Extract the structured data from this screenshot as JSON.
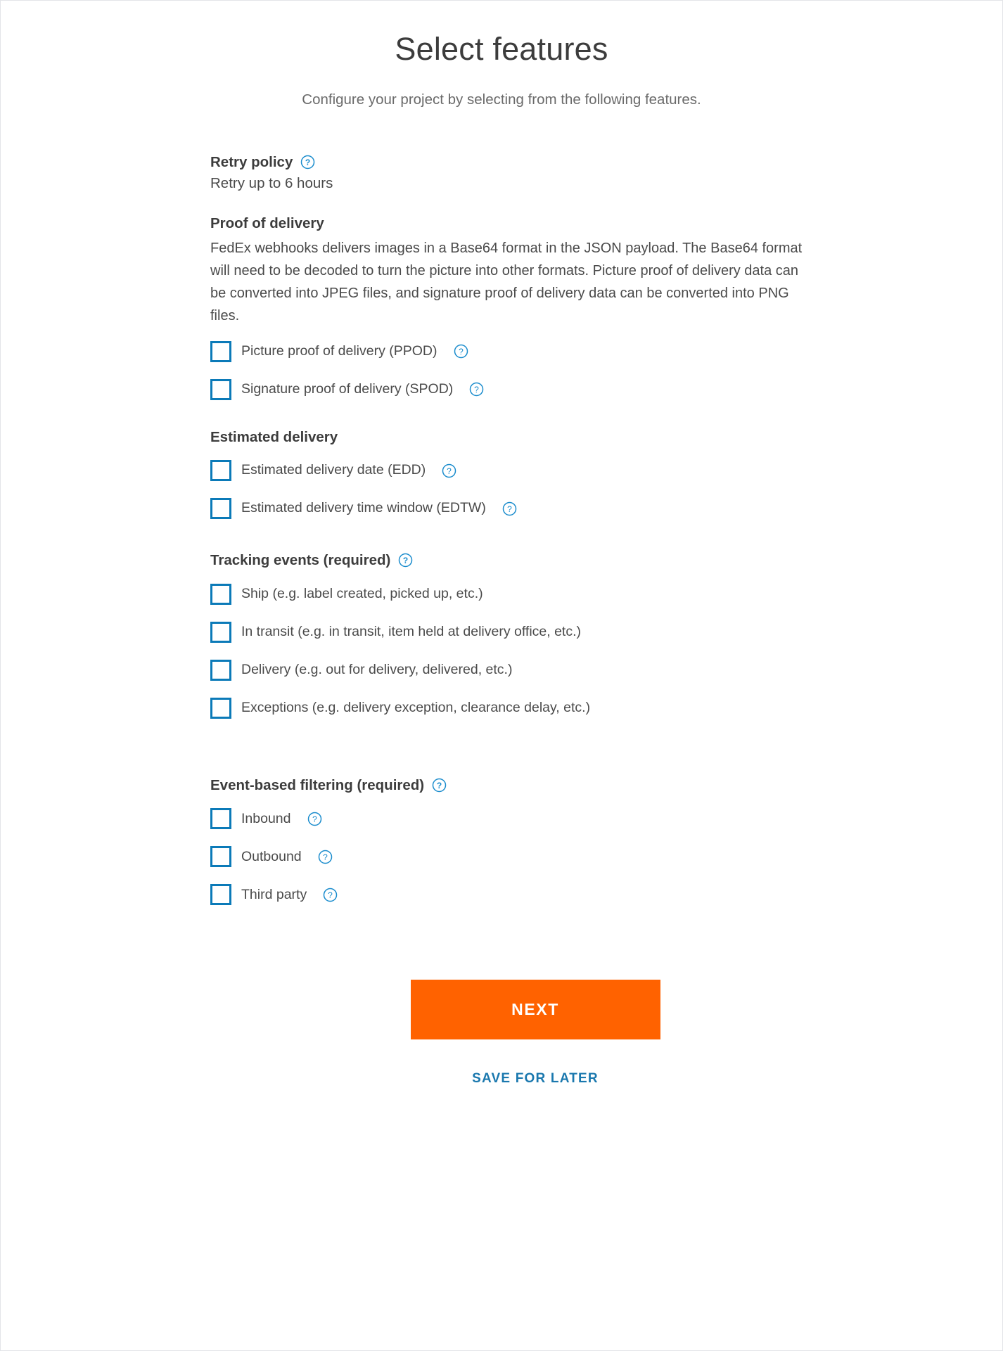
{
  "colors": {
    "accent_orange": "#ff6200",
    "link_blue": "#1a78ae",
    "checkbox_blue": "#0b7ab8",
    "help_icon_blue": "#1a8ccd",
    "text_dark": "#3c3c3c",
    "text_body": "#4a4a4a",
    "text_muted": "#6a6a6a",
    "page_border": "#e3e5e8"
  },
  "header": {
    "title": "Select features",
    "subtitle": "Configure your project by selecting from the following features."
  },
  "sections": {
    "retry_policy": {
      "heading": "Retry policy",
      "help_icon": "help-circle-icon",
      "value": "Retry up to 6 hours"
    },
    "proof_of_delivery": {
      "heading": "Proof of delivery",
      "description": "FedEx webhooks delivers images in a Base64 format in the JSON payload. The Base64 format will need to be decoded to turn the picture into other formats. Picture proof of delivery data can be converted into JPEG files, and signature proof of delivery data can be converted into PNG files.",
      "options": [
        {
          "label": "Picture proof of delivery (PPOD)",
          "checked": false,
          "help_icon": "help-circle-icon"
        },
        {
          "label": "Signature proof of delivery (SPOD)",
          "checked": false,
          "help_icon": "help-circle-icon"
        }
      ]
    },
    "estimated_delivery": {
      "heading": "Estimated delivery",
      "options": [
        {
          "label": "Estimated delivery date (EDD)",
          "checked": false,
          "help_icon": "help-circle-icon"
        },
        {
          "label": "Estimated delivery time window (EDTW)",
          "checked": false,
          "help_icon": "help-circle-icon"
        }
      ]
    },
    "tracking_events": {
      "heading": "Tracking events (required)",
      "help_icon": "help-circle-icon",
      "options": [
        {
          "label": "Ship (e.g. label created, picked up, etc.)",
          "checked": false
        },
        {
          "label": "In transit (e.g. in transit, item held at delivery office, etc.)",
          "checked": false
        },
        {
          "label": "Delivery (e.g. out for delivery, delivered, etc.)",
          "checked": false
        },
        {
          "label": "Exceptions (e.g. delivery exception, clearance delay, etc.)",
          "checked": false
        }
      ]
    },
    "event_based_filtering": {
      "heading": "Event-based filtering (required)",
      "help_icon": "help-circle-icon",
      "options": [
        {
          "label": "Inbound",
          "checked": false,
          "help_icon": "help-circle-icon"
        },
        {
          "label": "Outbound",
          "checked": false,
          "help_icon": "help-circle-icon"
        },
        {
          "label": "Third party",
          "checked": false,
          "help_icon": "help-circle-icon"
        }
      ]
    }
  },
  "footer": {
    "next_label": "NEXT",
    "save_for_later_label": "SAVE FOR LATER"
  }
}
